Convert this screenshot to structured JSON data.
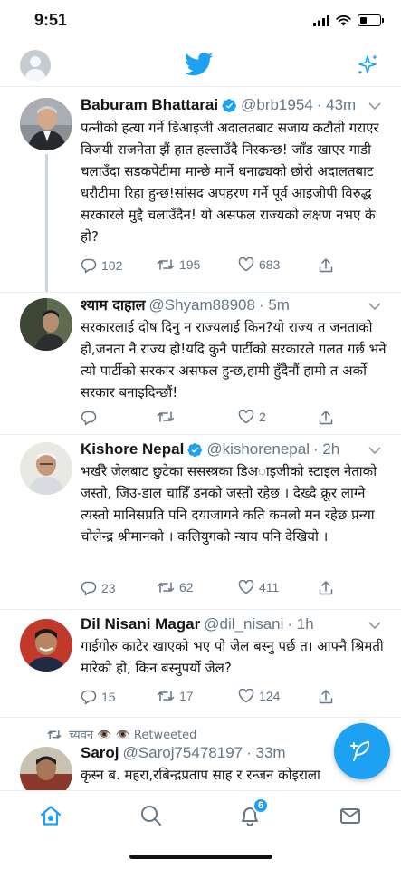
{
  "status_bar": {
    "time": "9:51",
    "battery_level": 0.35
  },
  "header": {
    "logo": "twitter-bird-icon",
    "left_icon": "profile-avatar",
    "right_icon": "sparkle-icon"
  },
  "tweets": [
    {
      "name": "Baburam Bhattarai",
      "verified": true,
      "handle": "@brb1954",
      "time": "· 43m",
      "text": "पत्नीको हत्या गर्ने डिआइजी अदालतबाट सजाय कटौती गराएर विजयी राजनेता झैं हात हल्लाउँदै निस्कन्छ! जाँड खाएर गाडी चलाउँदा सडकपेटीमा मान्छे मार्ने धनाढ्यको छोरो अदालतबाट धरौटीमा रिहा हुन्छ!सांसद अपहरण गर्ने पूर्व आइजीपी विरुद्ध सरकारले मुद्दै चलाउँदैन! यो असफल राज्यको लक्षण नभए के हो?",
      "replies": "102",
      "retweets": "195",
      "likes": "683"
    },
    {
      "name": "श्याम दाहाल",
      "verified": false,
      "handle": "@Shyam88908",
      "time": "· 5m",
      "text": "सरकारलाई दोष दिनु न राज्यलाई किन?यो राज्य त जनताको हो,जनता नै राज्य हो!यदि कुनै पार्टीको सरकारले गलत गर्छ भने त्यो पार्टीको सरकार असफल हुन्छ,हामी हुँदैनौं हामी त अर्को सरकार बनाइदिन्छौं!",
      "replies": "",
      "retweets": "",
      "likes": "2"
    },
    {
      "name": "Kishore Nepal",
      "verified": true,
      "handle": "@kishorenepal",
      "time": "· 2h",
      "text": "भर्खरै जेलबाट छुटेका ससस्त्रका डिअाइजीको स्टाइल नेताको जस्तो, जिउ-डाल चाहिँ डनको जस्तो रहेछ । देख्दै क्रूर लाग्ने त्यस्तो मानिसप्रति पनि दयाजागने कति कमलो मन रहेछ प्रन्या चोलेन्द्र श्रीमानको । कलियुगको न्याय पनि देखियो ।",
      "replies": "23",
      "retweets": "62",
      "likes": "411"
    },
    {
      "name": "Dil Nisani Magar",
      "verified": false,
      "handle": "@dil_nisani",
      "time": "· 1h",
      "text": "गाईगोरु काटेर खाएको भए पो जेल बस्नु पर्छ त। आफ्नै श्रिमती मारेको हो, किन बस्नुपर्यो जेल?",
      "replies": "15",
      "retweets": "17",
      "likes": "124"
    },
    {
      "retweeted_by": "च्यवन 👁️ 👁️ Retweeted",
      "name": "Saroj",
      "verified": false,
      "handle": "@Saroj75478197",
      "time": "· 33m",
      "text": "कृस्न ब. महरा,रबिन्द्रप्रताप साह र रन्जन कोइराला"
    }
  ],
  "tab_bar": {
    "items": [
      "home-icon",
      "search-icon",
      "notifications-icon",
      "messages-icon"
    ],
    "notification_count": "6"
  },
  "colors": {
    "accent": "#1da1f2",
    "text": "#14171a",
    "muted": "#657786",
    "divider": "#e6ecf0"
  }
}
